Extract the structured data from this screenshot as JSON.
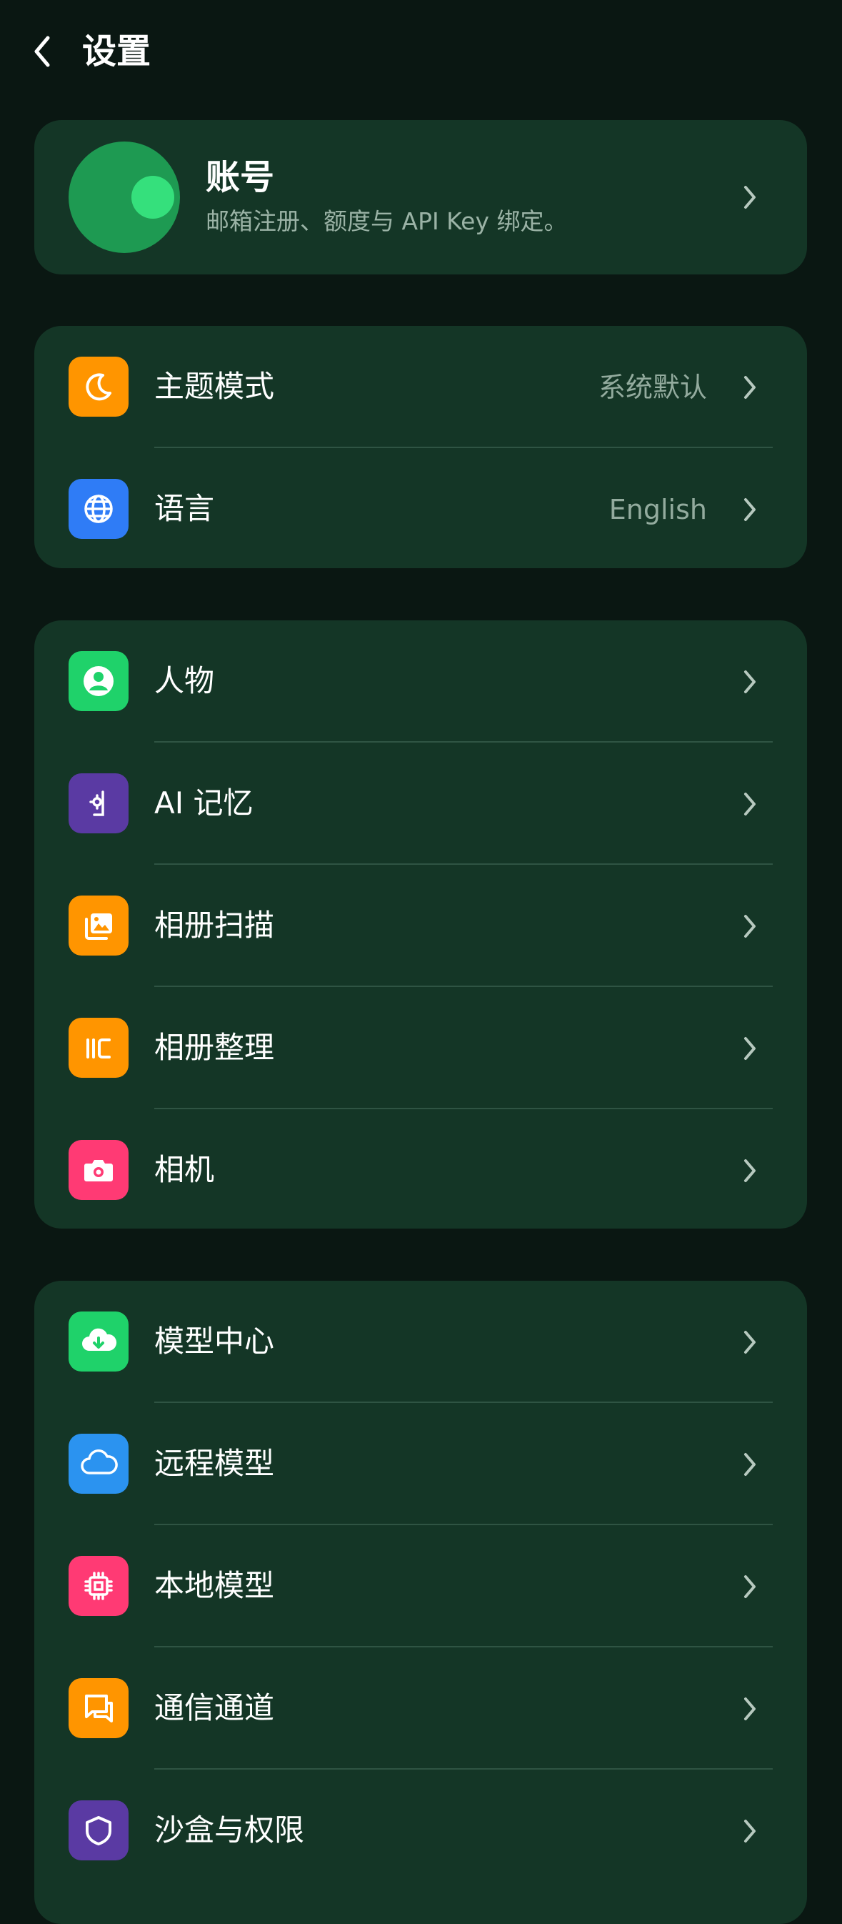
{
  "header": {
    "title": "设置"
  },
  "account": {
    "title": "账号",
    "subtitle": "邮箱注册、额度与 API Key 绑定。"
  },
  "groups": {
    "display": [
      {
        "label": "主题模式",
        "value": "系统默认",
        "icon": "moon-icon",
        "color": "#ff9500"
      },
      {
        "label": "语言",
        "value": "English",
        "icon": "globe-icon",
        "color": "#2f7cf6"
      }
    ],
    "features": [
      {
        "label": "人物",
        "icon": "person-icon",
        "color": "#1fd26a"
      },
      {
        "label": "AI 记忆",
        "icon": "memory-icon",
        "color": "#5a3aa3"
      },
      {
        "label": "相册扫描",
        "icon": "photo-scan-icon",
        "color": "#ff9500"
      },
      {
        "label": "相册整理",
        "icon": "organize-icon",
        "color": "#ff9500"
      },
      {
        "label": "相机",
        "icon": "camera-icon",
        "color": "#ff3a74"
      }
    ],
    "models": [
      {
        "label": "模型中心",
        "icon": "cloud-download-icon",
        "color": "#1fd26a"
      },
      {
        "label": "远程模型",
        "icon": "cloud-icon",
        "color": "#2b93f0"
      },
      {
        "label": "本地模型",
        "icon": "chip-icon",
        "color": "#ff3a74"
      },
      {
        "label": "通信通道",
        "icon": "chat-icon",
        "color": "#ff9500"
      },
      {
        "label": "沙盒与权限",
        "icon": "shield-icon",
        "color": "#5a3aa3"
      }
    ]
  }
}
